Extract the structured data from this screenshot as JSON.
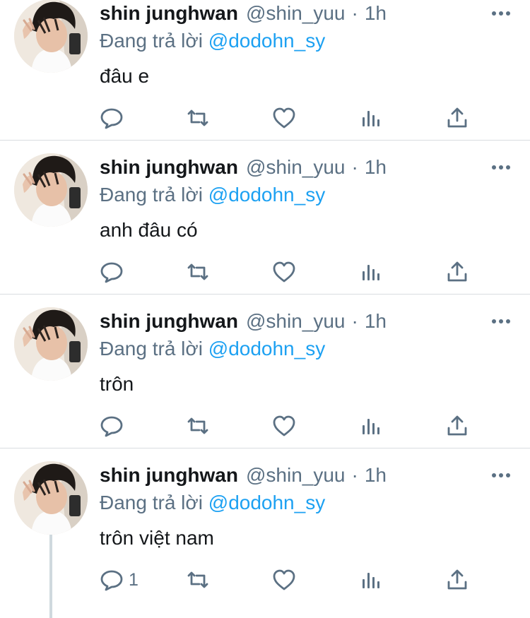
{
  "tweets": [
    {
      "display_name": "shin junghwan",
      "handle": "@shin_yuu",
      "separator": "·",
      "time": "1h",
      "reply_prefix": "Đang trả lời",
      "reply_to": "@dodohn_sy",
      "text": "đâu e",
      "reply_count": ""
    },
    {
      "display_name": "shin junghwan",
      "handle": "@shin_yuu",
      "separator": "·",
      "time": "1h",
      "reply_prefix": "Đang trả lời",
      "reply_to": "@dodohn_sy",
      "text": "anh đâu có",
      "reply_count": ""
    },
    {
      "display_name": "shin junghwan",
      "handle": "@shin_yuu",
      "separator": "·",
      "time": "1h",
      "reply_prefix": "Đang trả lời",
      "reply_to": "@dodohn_sy",
      "text": "trôn",
      "reply_count": ""
    },
    {
      "display_name": "shin junghwan",
      "handle": "@shin_yuu",
      "separator": "·",
      "time": "1h",
      "reply_prefix": "Đang trả lời",
      "reply_to": "@dodohn_sy",
      "text": "trôn việt nam",
      "reply_count": "1"
    }
  ],
  "icons": {
    "more": "more-horizontal-icon",
    "reply": "speech-bubble-icon",
    "retweet": "retweet-arrows-icon",
    "like": "heart-icon",
    "stats": "bar-chart-icon",
    "share": "share-upload-icon"
  },
  "colors": {
    "text": "#14171a",
    "secondary": "#5b7083",
    "link": "#1da1f2",
    "divider": "#d9dde0",
    "thread_line": "#cfd9de"
  }
}
